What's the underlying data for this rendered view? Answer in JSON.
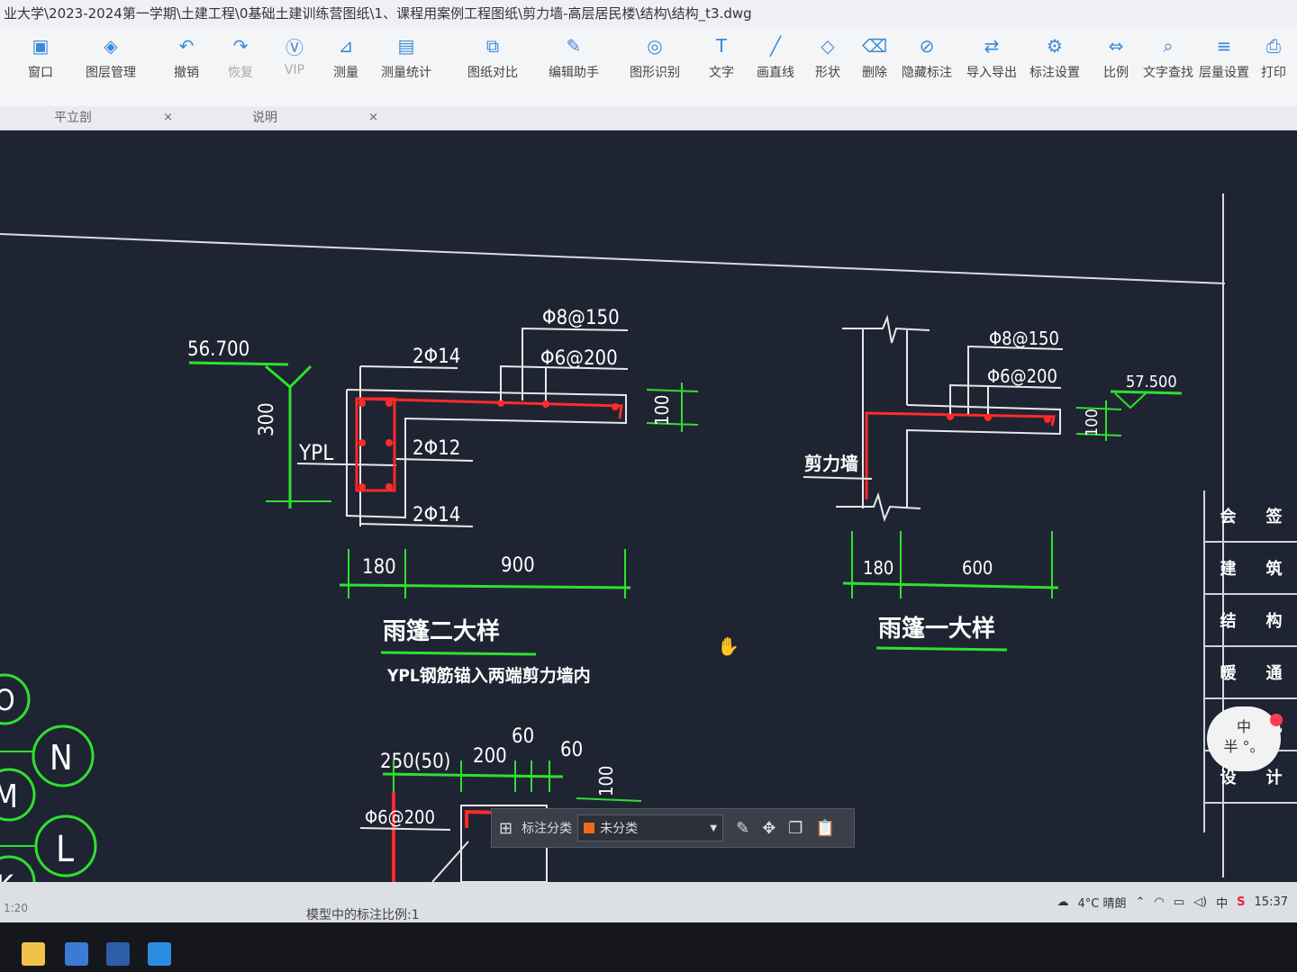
{
  "window": {
    "title": "业大学\\2023-2024第一学期\\土建工程\\0基础土建训练营图纸\\1、课程用案例工程图纸\\剪力墙-高层居民楼\\结构\\结构_t3.dwg"
  },
  "toolbar": {
    "items": [
      {
        "label": "窗口",
        "icon": "window-icon"
      },
      {
        "label": "图层管理",
        "icon": "layers-icon"
      },
      {
        "label": "撤销",
        "icon": "undo-icon"
      },
      {
        "label": "恢复",
        "icon": "redo-icon"
      },
      {
        "label": "VIP",
        "icon": "vip-badge-icon"
      },
      {
        "label": "测量",
        "icon": "measure-icon"
      },
      {
        "label": "测量统计",
        "icon": "measure-stats-icon"
      },
      {
        "label": "图纸对比",
        "icon": "compare-icon"
      },
      {
        "label": "编辑助手",
        "icon": "edit-assistant-icon"
      },
      {
        "label": "图形识别",
        "icon": "shape-recognize-icon"
      },
      {
        "label": "文字",
        "icon": "text-icon"
      },
      {
        "label": "画直线",
        "icon": "line-icon"
      },
      {
        "label": "形状",
        "icon": "shape-icon"
      },
      {
        "label": "删除",
        "icon": "eraser-icon"
      },
      {
        "label": "隐藏标注",
        "icon": "hide-annotation-icon"
      },
      {
        "label": "导入导出",
        "icon": "import-export-icon"
      },
      {
        "label": "标注设置",
        "icon": "annotation-settings-icon"
      },
      {
        "label": "比例",
        "icon": "scale-icon"
      },
      {
        "label": "文字查找",
        "icon": "text-search-icon"
      },
      {
        "label": "层量设置",
        "icon": "layer-settings-icon"
      },
      {
        "label": "打印",
        "icon": "print-icon"
      }
    ]
  },
  "tabs": [
    {
      "label": "平立剖"
    },
    {
      "label": "说明"
    }
  ],
  "drawing": {
    "detail2": {
      "title": "雨篷二大样",
      "note": "YPL钢筋锚入两端剪力墙内",
      "elevation": "56.700",
      "labels": {
        "top_bar": "Φ8@150",
        "dist_bar": "Φ6@200",
        "top_rebar": "2Φ14",
        "mid_rebar": "2Φ12",
        "bot_rebar": "2Φ14",
        "beam": "YPL"
      },
      "dims": {
        "height": "300",
        "thickness": "100",
        "beam_width": "180",
        "slab_length": "900"
      }
    },
    "detail1": {
      "title": "雨篷一大样",
      "elevation": "57.500",
      "labels": {
        "top_bar": "Φ8@150",
        "dist_bar": "Φ6@200",
        "wall": "剪力墙"
      },
      "dims": {
        "thickness": "100",
        "wall_width": "180",
        "slab_length": "600"
      }
    },
    "detail3": {
      "dims": {
        "d1": "250(50)",
        "d2": "200",
        "d3": "60",
        "d4": "60",
        "d5": "100"
      },
      "labels": {
        "dist_bar": "Φ6@200"
      }
    },
    "axis_bubbles": [
      "O",
      "N",
      "M",
      "L",
      "K"
    ],
    "title_block": {
      "rows": [
        [
          "会",
          "签"
        ],
        [
          "建",
          "筑"
        ],
        [
          "结",
          "构"
        ],
        [
          "暖",
          "通"
        ],
        [
          "电",
          "讯"
        ],
        [
          "设",
          "计"
        ]
      ]
    }
  },
  "float_bar": {
    "label": "标注分类",
    "category": "未分类",
    "category_color": "#f06a1c"
  },
  "status_bar": {
    "left_text": "1:20",
    "scale_text": "模型中的标注比例:1"
  },
  "system_tray": {
    "weather": "4°C 晴朗",
    "ime": "中",
    "time": "15:37"
  },
  "ime_widget": {
    "line1": "中",
    "line2": "半 °。"
  }
}
